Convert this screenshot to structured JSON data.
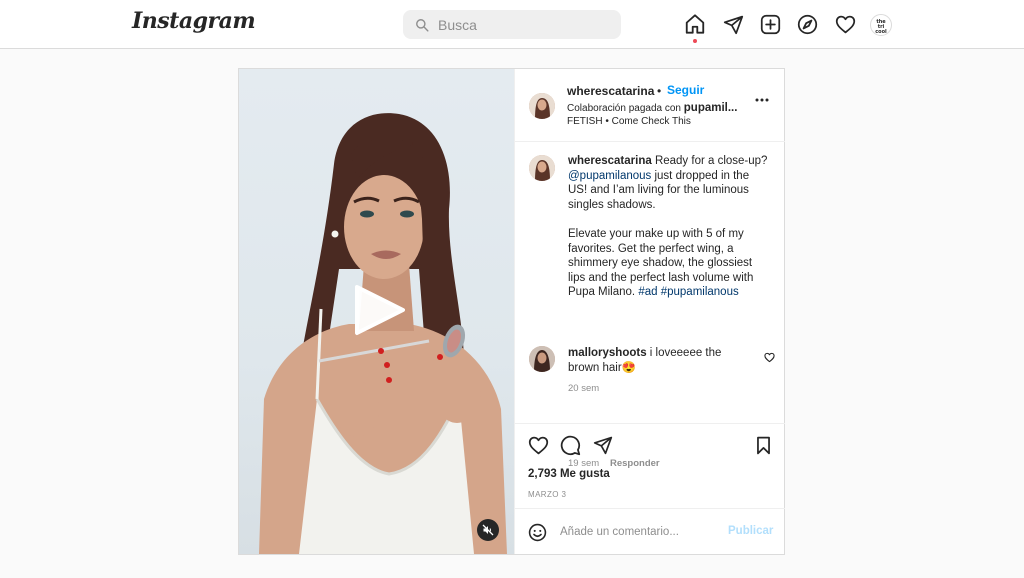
{
  "nav": {
    "logo": "Instagram",
    "search_placeholder": "Busca",
    "icons": [
      "home-icon",
      "direct-icon",
      "new-post-icon",
      "explore-icon",
      "activity-icon"
    ],
    "profile_text": "the\ntri\ncool"
  },
  "post": {
    "author": "wherescatarina",
    "dot": "•",
    "follow_label": "Seguir",
    "collab_prefix": "Colaboración pagada con ",
    "collab_partner": "pupamil...",
    "audio": "FETISH • Come Check This",
    "caption": {
      "user": "wherescatarina",
      "part1": " Ready for a close-up? ",
      "mention": "@pupamilanous",
      "part2": " just dropped in the US! and I’am living for the luminous singles shadows.",
      "para2_text": "Elevate your make up with 5 of my favorites. Get the perfect wing, a shimmery eye shadow, the glossiest lips and the perfect lash volume with Pupa Milano. ",
      "tag1": "#ad",
      "tag2": "#pupamilanous"
    },
    "caption_time": "20 sem",
    "comment": {
      "user": "malloryshoots",
      "text": " i loveeeee the brown hair😍",
      "time": "19 sem",
      "reply_label": "Responder"
    },
    "likes": "2,793 Me gusta",
    "date": "MARZO 3",
    "add_comment_placeholder": "Añade un comentario...",
    "publish_label": "Publicar"
  },
  "colors": {
    "accent": "#0095f6",
    "link": "#00376b",
    "muted": "#8e8e8e",
    "notification": "#ed4956"
  }
}
